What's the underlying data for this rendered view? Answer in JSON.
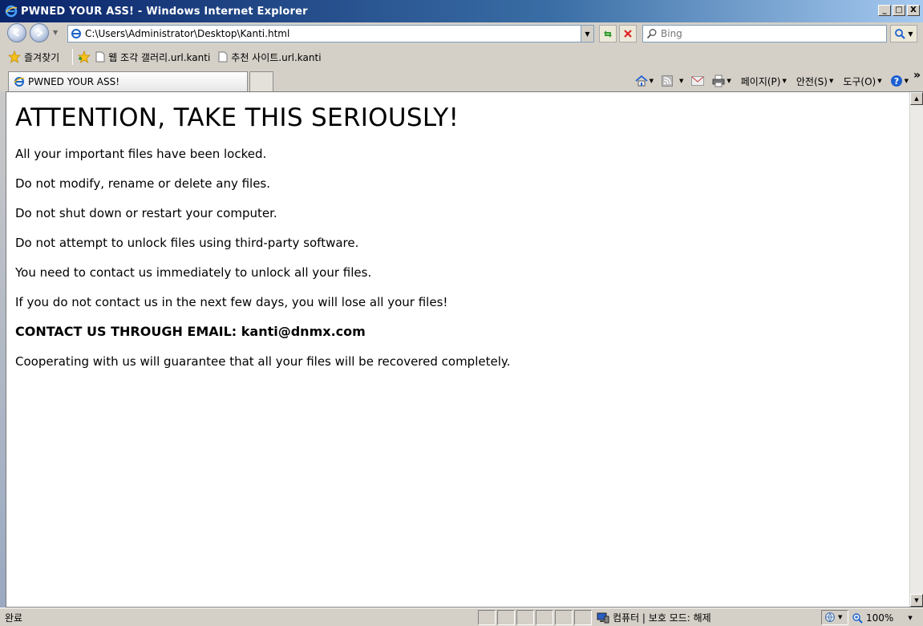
{
  "window": {
    "title": "PWNED YOUR ASS! - Windows Internet Explorer",
    "minimize": "_",
    "maximize": "□",
    "close": "X"
  },
  "address_bar": {
    "url": "C:\\Users\\Administrator\\Desktop\\Kanti.html",
    "search_placeholder": "Bing"
  },
  "favorites_bar": {
    "favorites_label": "즐겨찾기",
    "items": [
      {
        "label": "웹 조각 갤러리.url.kanti"
      },
      {
        "label": "추천 사이트.url.kanti"
      }
    ]
  },
  "tabs": [
    {
      "label": "PWNED YOUR ASS!"
    }
  ],
  "command_bar": {
    "page": "페이지(P)",
    "safety": "안전(S)",
    "tools": "도구(O)",
    "more": "»"
  },
  "content": {
    "heading": "ATTENTION, TAKE THIS SERIOUSLY!",
    "paragraphs": [
      "All your important files have been locked.",
      "Do not modify, rename or delete any files.",
      "Do not shut down or restart your computer.",
      "Do not attempt to unlock files using third-party software.",
      "You need to contact us immediately to unlock all your files.",
      "If you do not contact us in the next few days, you will lose all your files!"
    ],
    "contact": "CONTACT US THROUGH EMAIL: kanti@dnmx.com",
    "closing": "Cooperating with us will guarantee that all your files will be recovered completely."
  },
  "status_bar": {
    "status": "완료",
    "zone": "컴퓨터 | 보호 모드: 해제",
    "zoom": "100%"
  },
  "colors": {
    "titlebar_start": "#0a246a",
    "titlebar_end": "#a6caf0",
    "chrome": "#d4d0c8"
  }
}
